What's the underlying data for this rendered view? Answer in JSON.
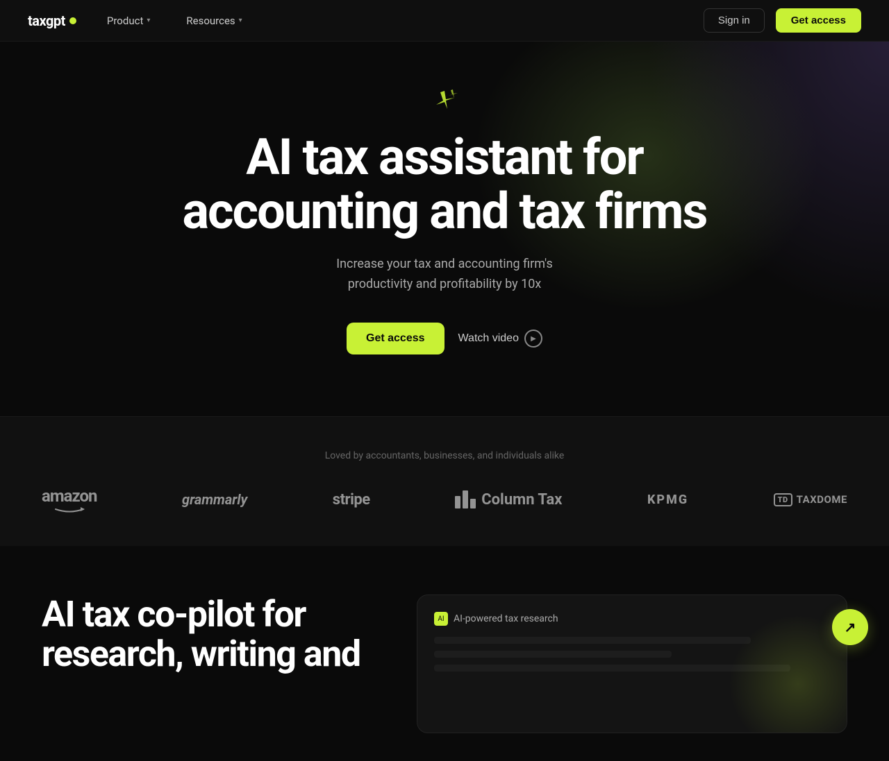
{
  "brand": {
    "name": "taxgpt",
    "logo_dot_color": "#c8f135"
  },
  "nav": {
    "product_label": "Product",
    "resources_label": "Resources",
    "sign_in_label": "Sign in",
    "get_access_label": "Get access"
  },
  "hero": {
    "title_line1": "AI tax assistant for",
    "title_line2": "accounting and tax firms",
    "subtitle_line1": "Increase your tax and accounting firm's",
    "subtitle_line2": "productivity and profitability by 10x",
    "cta_primary": "Get access",
    "cta_secondary": "Watch video"
  },
  "logos": {
    "label": "Loved by accountants, businesses, and individuals alike",
    "items": [
      {
        "name": "amazon",
        "text": "amazon"
      },
      {
        "name": "grammarly",
        "text": "grammarly"
      },
      {
        "name": "stripe",
        "text": "stripe"
      },
      {
        "name": "columntax",
        "text": "Column Tax"
      },
      {
        "name": "kpmg",
        "text": "KPMG"
      },
      {
        "name": "taxdome",
        "text": "TAXDOME",
        "badge": "TD"
      }
    ]
  },
  "lower": {
    "title_line1": "AI tax co-pilot for",
    "title_line2": "research, writing and",
    "ai_badge_text": "AI-powered tax research"
  },
  "scroll_btn": "↗"
}
